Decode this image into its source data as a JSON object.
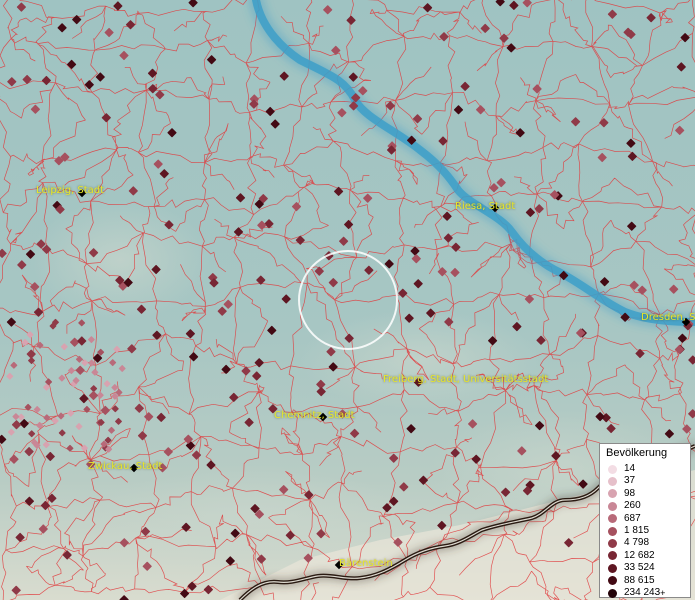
{
  "cities": [
    {
      "name": "Leipzig, Stadt"
    },
    {
      "name": "Riesa, Stadt"
    },
    {
      "name": "Dresden, S"
    },
    {
      "name": "Freiberg, Stadt, Universitätsstadt"
    },
    {
      "name": "Chemnitz, Stadt"
    },
    {
      "name": "Zwickau, Stadt"
    },
    {
      "name": "Bärenstein"
    }
  ],
  "legend": {
    "title": "Bevölkerung",
    "items": [
      {
        "label": "14",
        "color": "#f3dde4"
      },
      {
        "label": "37",
        "color": "#e6c0ca"
      },
      {
        "label": "98",
        "color": "#d8a3b0"
      },
      {
        "label": "260",
        "color": "#c98796"
      },
      {
        "label": "687",
        "color": "#b86a79"
      },
      {
        "label": "1 815",
        "color": "#a6515f"
      },
      {
        "label": "4 798",
        "color": "#903a48"
      },
      {
        "label": "12 682",
        "color": "#782634"
      },
      {
        "label": "33 524",
        "color": "#5e1622"
      },
      {
        "label": "88 615",
        "color": "#430a14"
      },
      {
        "label": "234 243",
        "color": "#230208",
        "suffix": "+"
      }
    ]
  },
  "colors": {
    "boundary": "#e0393c",
    "river": "#3d9fc8",
    "border": "#2a1a12",
    "label": "#e8e62a",
    "city_marker": "#000000"
  }
}
